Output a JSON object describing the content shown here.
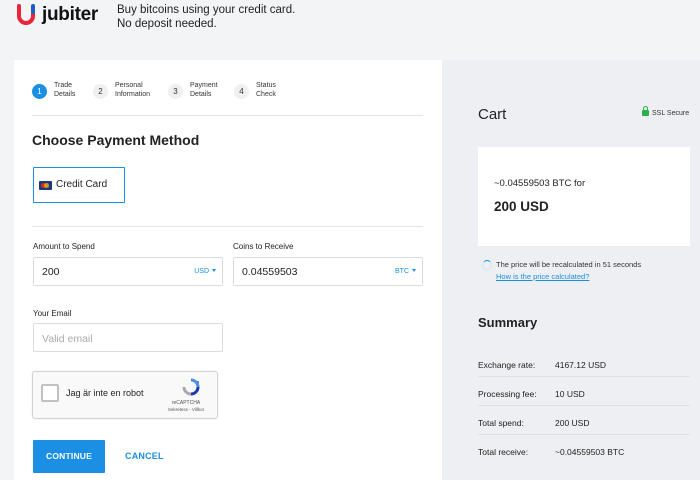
{
  "header": {
    "logo_text": "jubiter",
    "tagline_line1": "Buy bitcoins using your credit card.",
    "tagline_line2": "No deposit needed."
  },
  "steps": [
    {
      "number": "1",
      "label": "Trade\nDetails",
      "active": true
    },
    {
      "number": "2",
      "label": "Personal\nInformation",
      "active": false
    },
    {
      "number": "3",
      "label": "Payment\nDetails",
      "active": false
    },
    {
      "number": "4",
      "label": "Status\nCheck",
      "active": false
    }
  ],
  "payment": {
    "title": "Choose Payment Method",
    "method_label": "Credit Card"
  },
  "form": {
    "amount_label": "Amount to Spend",
    "amount_value": "200",
    "amount_currency": "USD",
    "coins_label": "Coins to Receive",
    "coins_value": "0.04559503",
    "coins_currency": "BTC",
    "email_label": "Your Email",
    "email_placeholder": "Valid email"
  },
  "captcha": {
    "label": "Jag är inte en robot",
    "brand": "reCAPTCHA",
    "links": "Sekretess - Villkor"
  },
  "actions": {
    "continue_label": "CONTINUE",
    "cancel_label": "CANCEL"
  },
  "cart": {
    "title": "Cart",
    "ssl_label": "SSL Secure",
    "quote_btc": "~0.04559503 BTC for",
    "quote_usd": "200 USD",
    "recalc_text": "The price will be recalculated in 51 seconds",
    "how_link": "How is the price calculated?"
  },
  "summary": {
    "title": "Summary",
    "rows": [
      {
        "key": "Exchange rate:",
        "value": "4167.12 USD"
      },
      {
        "key": "Processing fee:",
        "value": "10 USD"
      },
      {
        "key": "Total spend:",
        "value": "200 USD"
      },
      {
        "key": "Total receive:",
        "value": "~0.04559503 BTC"
      }
    ]
  },
  "colors": {
    "accent": "#1a8fe3",
    "logo_red": "#e8253a",
    "logo_blue": "#1a5fc8",
    "ssl_green": "#2ab24a"
  }
}
